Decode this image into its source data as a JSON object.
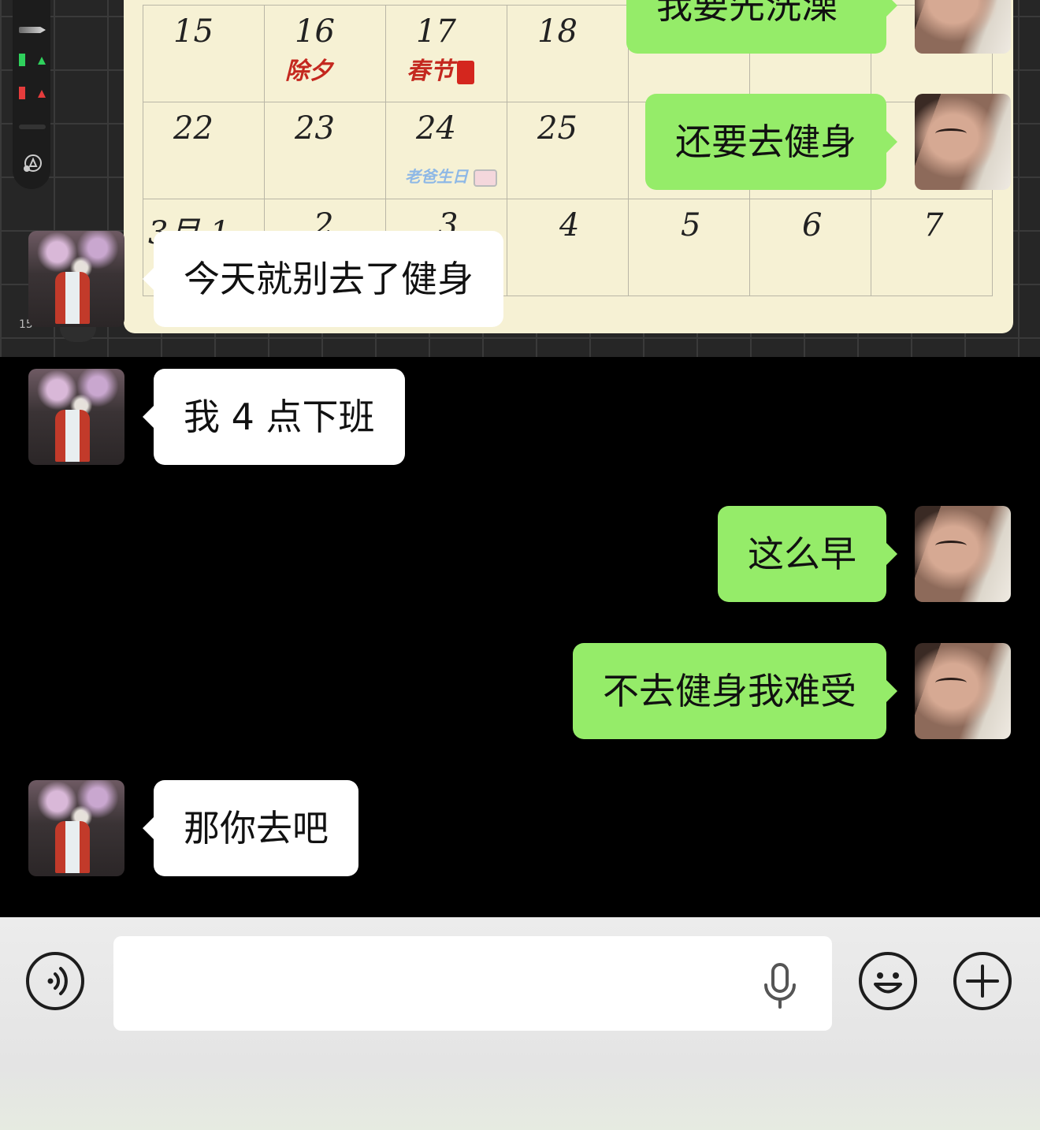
{
  "background_app": {
    "zoom_label": "15",
    "calendar": {
      "weeks": [
        [
          {
            "day": "15",
            "note": ""
          },
          {
            "day": "16",
            "note": "除夕"
          },
          {
            "day": "17",
            "note": "春节"
          },
          {
            "day": "18",
            "note": ""
          },
          {
            "day": "",
            "note": ""
          },
          {
            "day": "",
            "note": ""
          },
          {
            "day": "",
            "note": ""
          }
        ],
        [
          {
            "day": "22",
            "note": ""
          },
          {
            "day": "23",
            "note": ""
          },
          {
            "day": "24",
            "note": "老爸生日"
          },
          {
            "day": "25",
            "note": ""
          },
          {
            "day": "",
            "note": ""
          },
          {
            "day": "",
            "note": ""
          },
          {
            "day": "",
            "note": ""
          }
        ],
        [
          {
            "day": "3月.1",
            "note": ""
          },
          {
            "day": "2",
            "note": ""
          },
          {
            "day": "3",
            "note": ""
          },
          {
            "day": "4",
            "note": ""
          },
          {
            "day": "5",
            "note": ""
          },
          {
            "day": "6",
            "note": ""
          },
          {
            "day": "7",
            "note": ""
          }
        ]
      ]
    }
  },
  "messages": [
    {
      "side": "right",
      "text": "我要先洗澡"
    },
    {
      "side": "right",
      "text": "还要去健身"
    },
    {
      "side": "left",
      "text": "今天就别去了健身"
    },
    {
      "side": "left",
      "text": "我 4 点下班"
    },
    {
      "side": "right",
      "text": "这么早"
    },
    {
      "side": "right",
      "text": "不去健身我难受"
    },
    {
      "side": "left",
      "text": "那你去吧"
    }
  ],
  "input_bar": {
    "text_value": "",
    "icons": [
      "voice-icon",
      "microphone-icon",
      "emoji-icon",
      "plus-icon"
    ]
  },
  "colors": {
    "sent_bubble": "#95ec69",
    "received_bubble": "#ffffff",
    "chat_background": "#000000"
  }
}
